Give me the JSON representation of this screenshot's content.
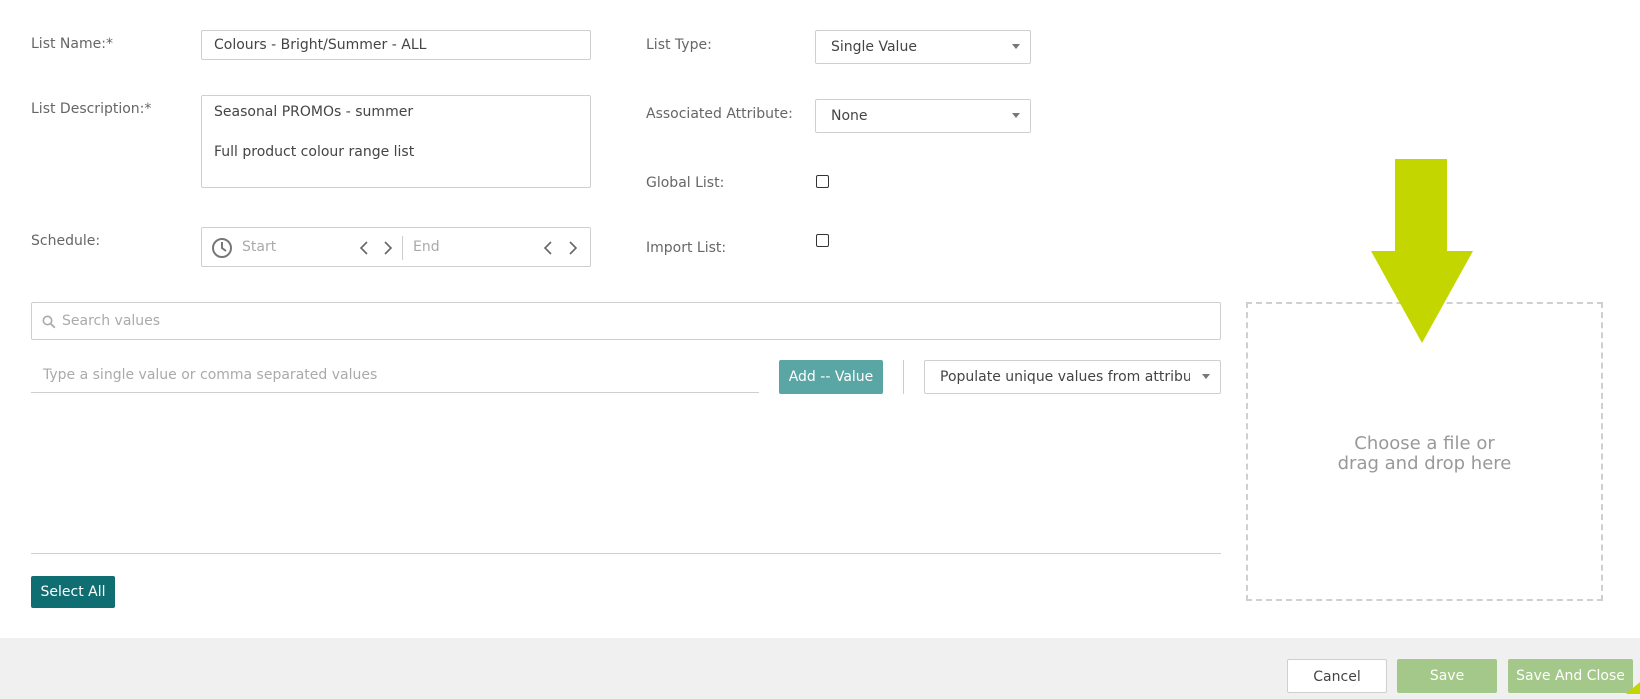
{
  "form": {
    "list_name": {
      "label": "List Name:*",
      "value": "Colours - Bright/Summer - ALL"
    },
    "list_description": {
      "label": "List Description:*",
      "line1": "Seasonal PROMOs - summer",
      "line2": "Full product colour range list"
    },
    "schedule": {
      "label": "Schedule:",
      "start_placeholder": "Start",
      "end_placeholder": "End"
    },
    "list_type": {
      "label": "List Type:",
      "value": "Single Value"
    },
    "associated_attribute": {
      "label": "Associated Attribute:",
      "value": "None"
    },
    "global_list": {
      "label": "Global List:",
      "checked": false
    },
    "import_list": {
      "label": "Import List:",
      "checked": false
    }
  },
  "values": {
    "search_placeholder": "Search values",
    "add_placeholder": "Type a single value or comma separated values",
    "add_button": "Add -- Value",
    "populate_select": "Populate unique values from attribute",
    "select_all": "Select All"
  },
  "upload": {
    "line1": "Choose a file or",
    "line2": "drag and drop here"
  },
  "footer": {
    "cancel": "Cancel",
    "save": "Save",
    "save_and_close": "Save And Close"
  },
  "colors": {
    "teal": "#0f6e72",
    "add_button": "#5aa6a4",
    "save_green": "#a4c88a",
    "arrow": "#c4d600"
  }
}
